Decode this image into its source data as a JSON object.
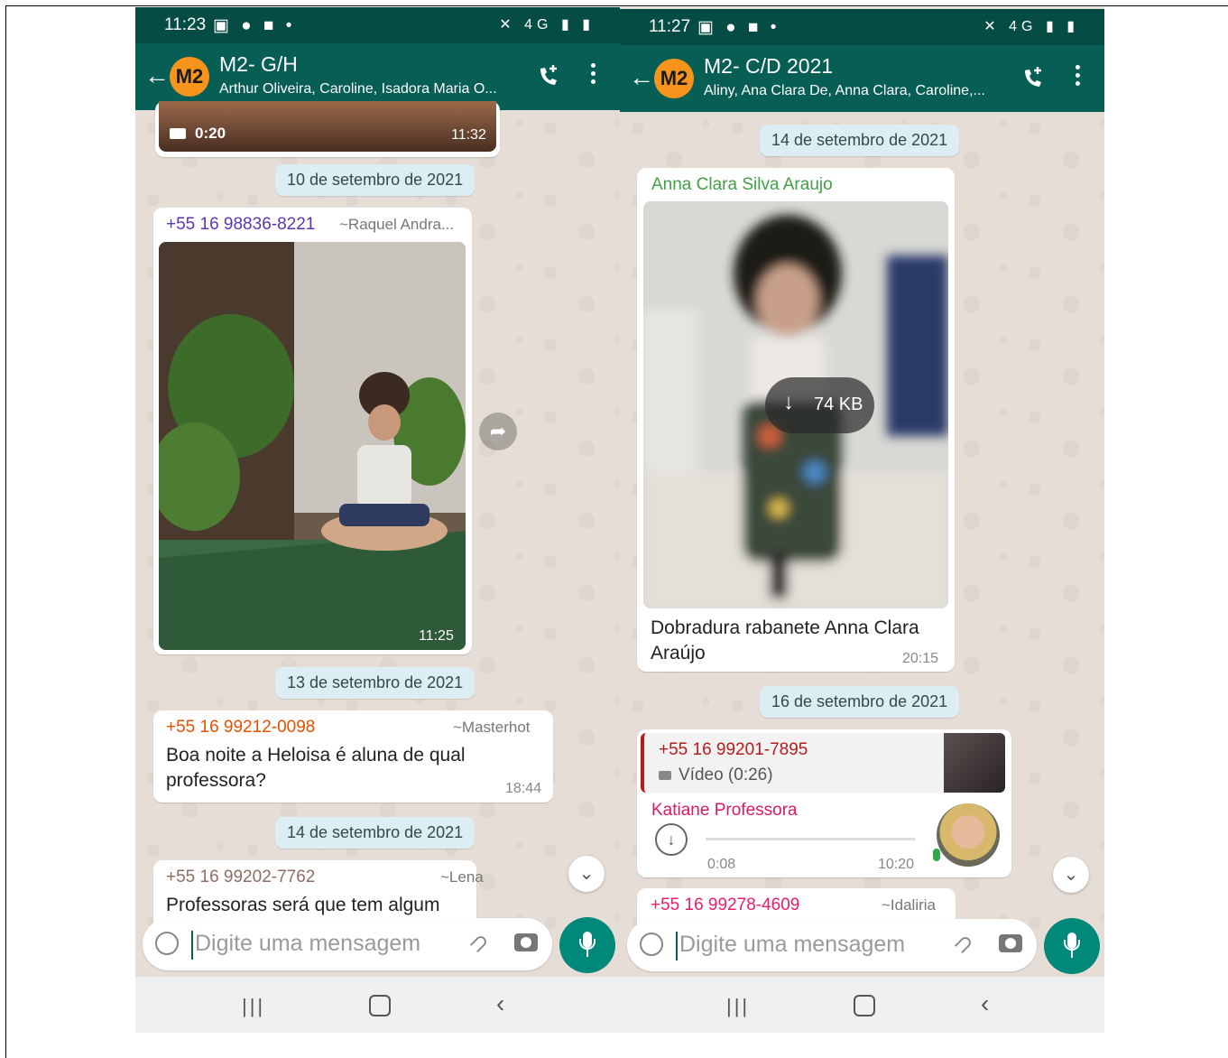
{
  "colors": {
    "header": "#075e54",
    "status_bar": "#054d44",
    "avatar": "#f7941d",
    "date_pill": "#dcedf4",
    "mic_button": "#00897b"
  },
  "left": {
    "status_time": "11:23",
    "group_avatar": "M2",
    "group_name": "M2- G/H",
    "participants": "Arthur Oliveira, Caroline, Isadora Maria O...",
    "video_duration": "0:20",
    "video_time": "11:32",
    "date1": "10 de setembro de 2021",
    "msg1": {
      "sender": "+55 16 98836-8221",
      "alias": "~Raquel Andra...",
      "time": "11:25"
    },
    "date2": "13 de setembro de 2021",
    "msg2": {
      "sender": "+55 16 99212-0098",
      "alias": "~Masterhot",
      "text1": "Boa noite a Heloisa é aluna de qual",
      "text2": "professora?",
      "time": "18:44"
    },
    "date3": "14 de setembro de 2021",
    "msg3": {
      "sender": "+55 16 99202-7762",
      "alias": "~Lena",
      "text": "Professoras será que tem algum"
    },
    "input_placeholder": "Digite uma mensagem"
  },
  "right": {
    "status_time": "11:27",
    "group_avatar": "M2",
    "group_name": "M2- C/D 2021",
    "participants": "Aliny, Ana Clara De, Anna Clara, Caroline,...",
    "date1": "14 de setembro de 2021",
    "msg1": {
      "sender": "Anna Clara Silva Araujo",
      "download_size": "74 KB",
      "caption1": "Dobradura rabanete Anna Clara",
      "caption2": "Araújo",
      "time": "20:15"
    },
    "date2": "16 de setembro de 2021",
    "msg2": {
      "quoted_sender": "+55 16 99201-7895",
      "quoted_text": "Vídeo (0:26)",
      "sender": "Katiane Professora",
      "audio_duration": "0:08",
      "time": "10:20"
    },
    "msg3": {
      "sender": "+55 16 99278-4609",
      "alias": "~Idaliria"
    },
    "input_placeholder": "Digite uma mensagem"
  },
  "icons": [
    "back-arrow-icon",
    "add-call-icon",
    "more-vert-icon",
    "video-icon",
    "forward-icon",
    "chevron-double-down-icon",
    "emoji-icon",
    "attach-icon",
    "camera-icon",
    "mic-icon",
    "download-icon",
    "recent-apps-icon",
    "home-icon",
    "nav-back-icon"
  ]
}
